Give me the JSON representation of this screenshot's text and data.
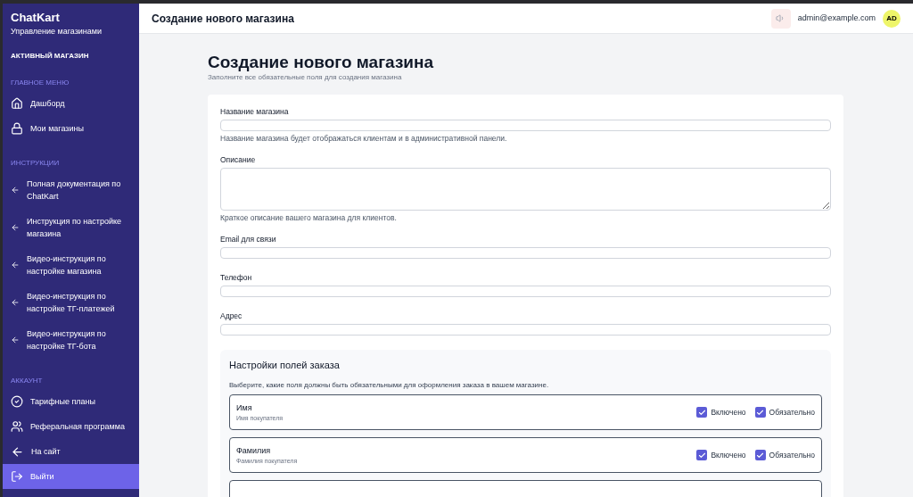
{
  "sidebar": {
    "brand": "ChatKart",
    "subtitle": "Управление магазинами",
    "active_store_label": "АКТИВНЫЙ МАГАЗИН",
    "sections": [
      {
        "title": "ГЛАВНОЕ МЕНЮ",
        "items": [
          {
            "label": "Дашборд",
            "kind": "home",
            "selected": false
          },
          {
            "label": "Мои магазины",
            "kind": "lock",
            "selected": false
          }
        ]
      },
      {
        "title": "ИНСТРУКЦИИ",
        "items": [
          {
            "label": "Полная документация по ChatKart",
            "kind": "link",
            "selected": false
          },
          {
            "label": "Инструкция по настройке магазина",
            "kind": "link",
            "selected": false
          },
          {
            "label": "Видео-инструкция по настройке магазина",
            "kind": "link",
            "selected": false
          },
          {
            "label": "Видео-инструкция по настройке ТГ-платежей",
            "kind": "link",
            "selected": false
          },
          {
            "label": "Видео-инструкция по настройке ТГ-бота",
            "kind": "link",
            "selected": false
          }
        ]
      },
      {
        "title": "АККАУНТ",
        "items": [
          {
            "label": "Тарифные планы",
            "kind": "plans",
            "selected": false
          },
          {
            "label": "Реферальная программа",
            "kind": "users",
            "selected": false
          },
          {
            "label": "На сайт",
            "kind": "back",
            "selected": false
          },
          {
            "label": "Выйти",
            "kind": "logout",
            "selected": true
          }
        ]
      }
    ]
  },
  "header": {
    "title": "Создание нового магазина",
    "user_email": "admin@example.com",
    "avatar": "AD"
  },
  "page": {
    "title": "Создание нового магазина",
    "subtitle": "Заполните все обязательные поля для создания магазина"
  },
  "form": {
    "fields": [
      {
        "label": "Название магазина",
        "kind": "input",
        "help": "Название магазина будет отображаться клиентам и в административной панели."
      },
      {
        "label": "Описание",
        "kind": "textarea",
        "help": "Краткое описание вашего магазина для клиентов."
      },
      {
        "label": "Email для связи",
        "kind": "input"
      },
      {
        "label": "Телефон",
        "kind": "input"
      },
      {
        "label": "Адрес",
        "kind": "input"
      }
    ]
  },
  "order_fields": {
    "title": "Настройки полей заказа",
    "description": "Выберите, какие поля должны быть обязательными для оформления заказа в вашем магазине.",
    "rows": [
      {
        "name": "Имя",
        "hint": "Имя покупателя",
        "enabled_label": "Включено",
        "enabled": true,
        "required_label": "Обязательно",
        "required": true
      },
      {
        "name": "Фамилия",
        "hint": "Фамилия покупателя",
        "enabled_label": "Включено",
        "enabled": true,
        "required_label": "Обязательно",
        "required": true
      }
    ]
  }
}
